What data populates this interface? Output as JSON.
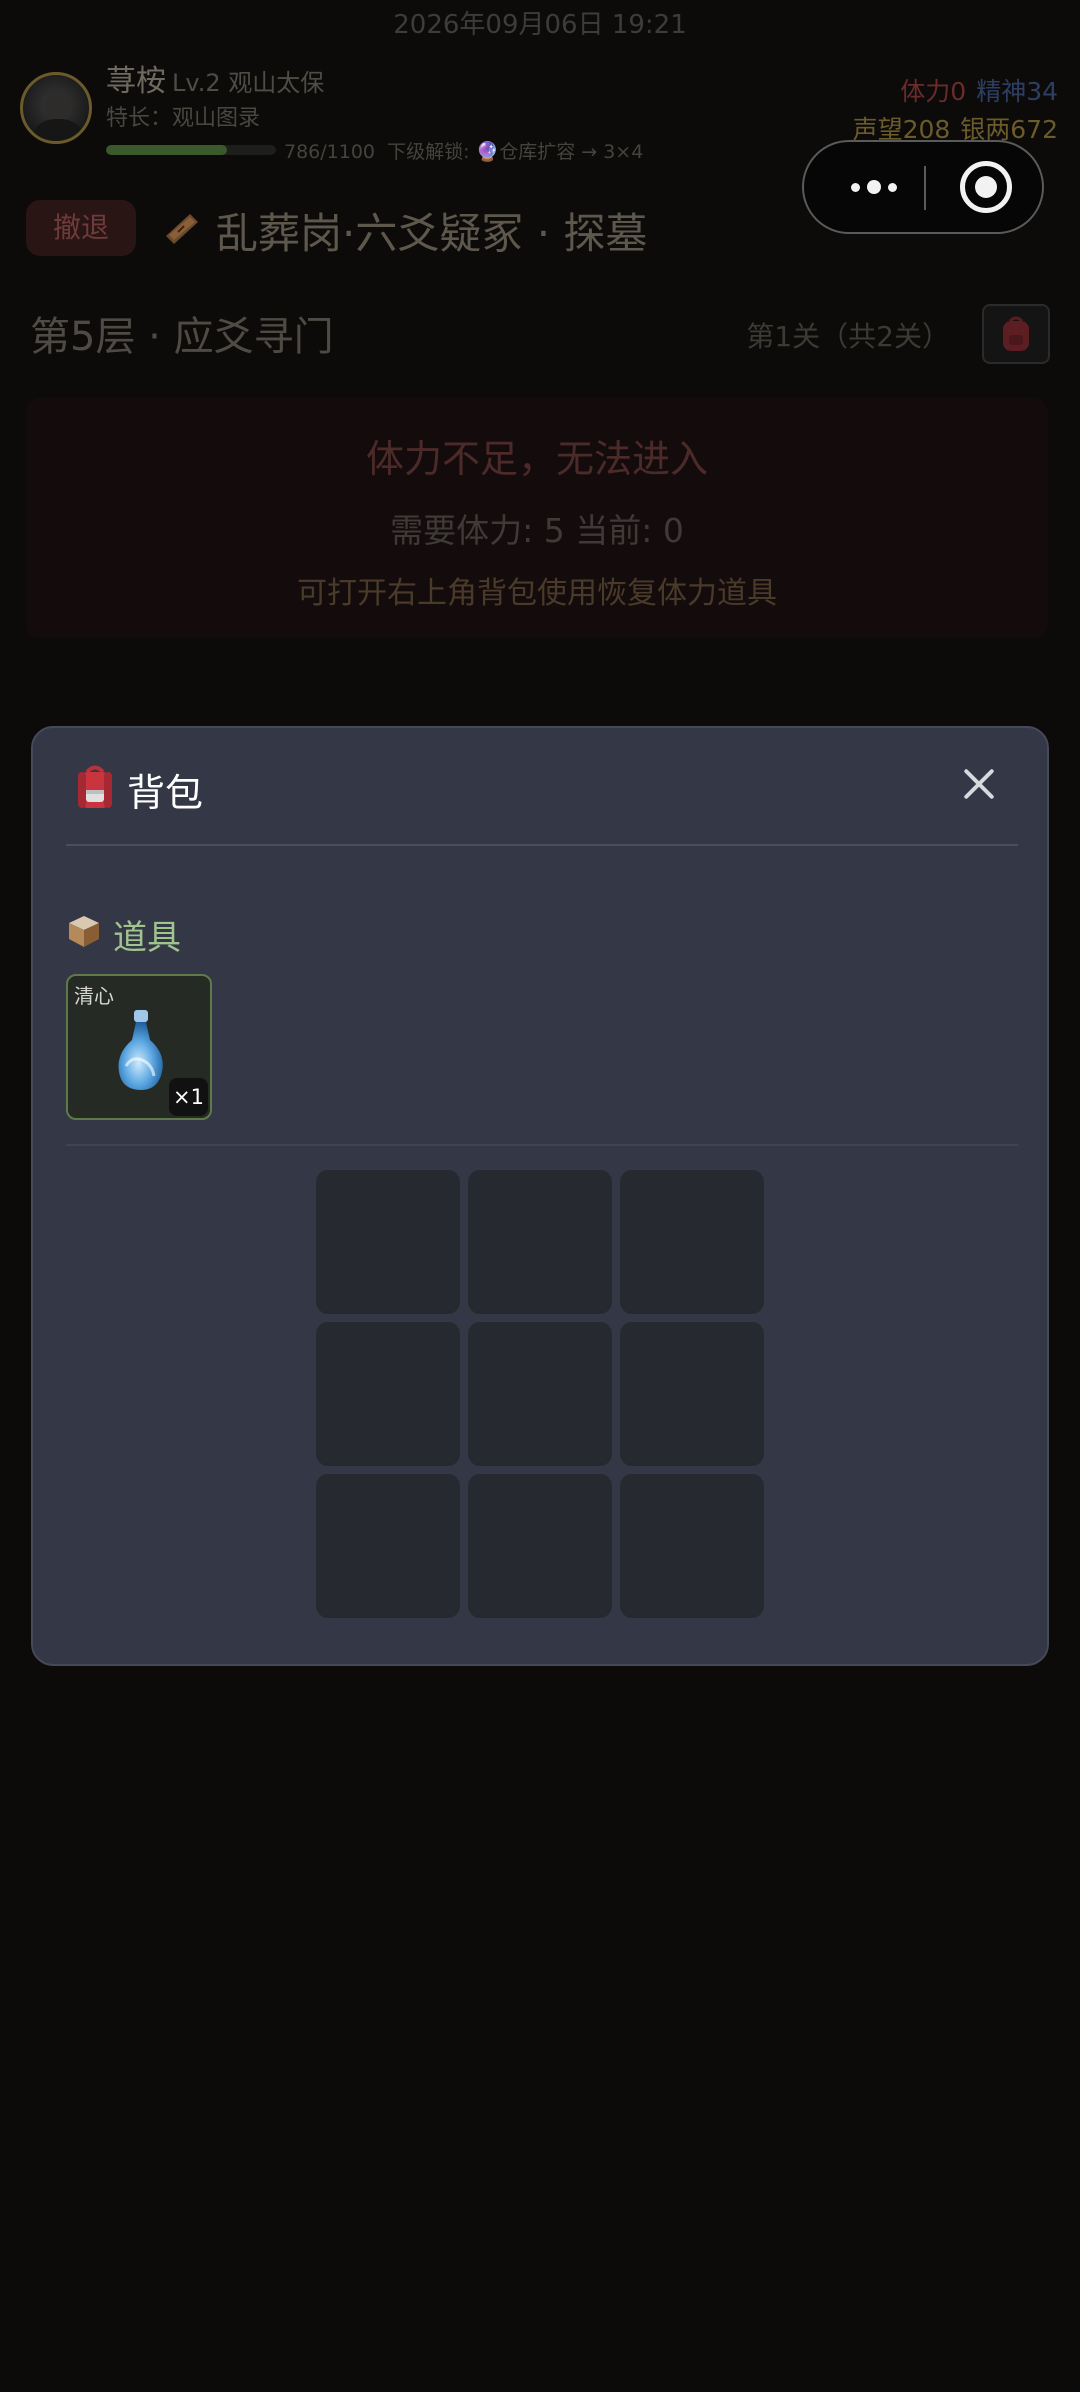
{
  "status": {
    "datetime": "2026年09月06日 19:21"
  },
  "player": {
    "name": "荨桉",
    "level": "Lv.2",
    "rank": "观山太保",
    "specialty": "特长：观山图录",
    "xp_text": "786/1100",
    "xp_fraction": 0.7145,
    "unlock_text": "下级解锁: 🔮仓库扩容 → 3×4"
  },
  "stats": {
    "stamina": "体力0",
    "spirit": "精神34",
    "reputation": "声望208",
    "silver": "银两672",
    "stamina_color": "#6a2b2b",
    "spirit_color": "#2e3e63"
  },
  "header": {
    "retreat_label": "撤退",
    "location": "乱葬岗·六爻疑冢 · 探墓"
  },
  "floor": {
    "title": "第5层 · 应爻寻门",
    "stage": "第1关（共2关）"
  },
  "warning": {
    "title": "体力不足，无法进入",
    "need": "需要体力: 5  当前: 0",
    "tip": "可打开右上角背包使用恢复体力道具"
  },
  "backpack": {
    "title": "背包",
    "section_title": "道具",
    "items": [
      {
        "name": "清心",
        "quantity": "×1",
        "icon": "potion-bottle-icon"
      }
    ],
    "accent_color": "#9fc48d"
  }
}
